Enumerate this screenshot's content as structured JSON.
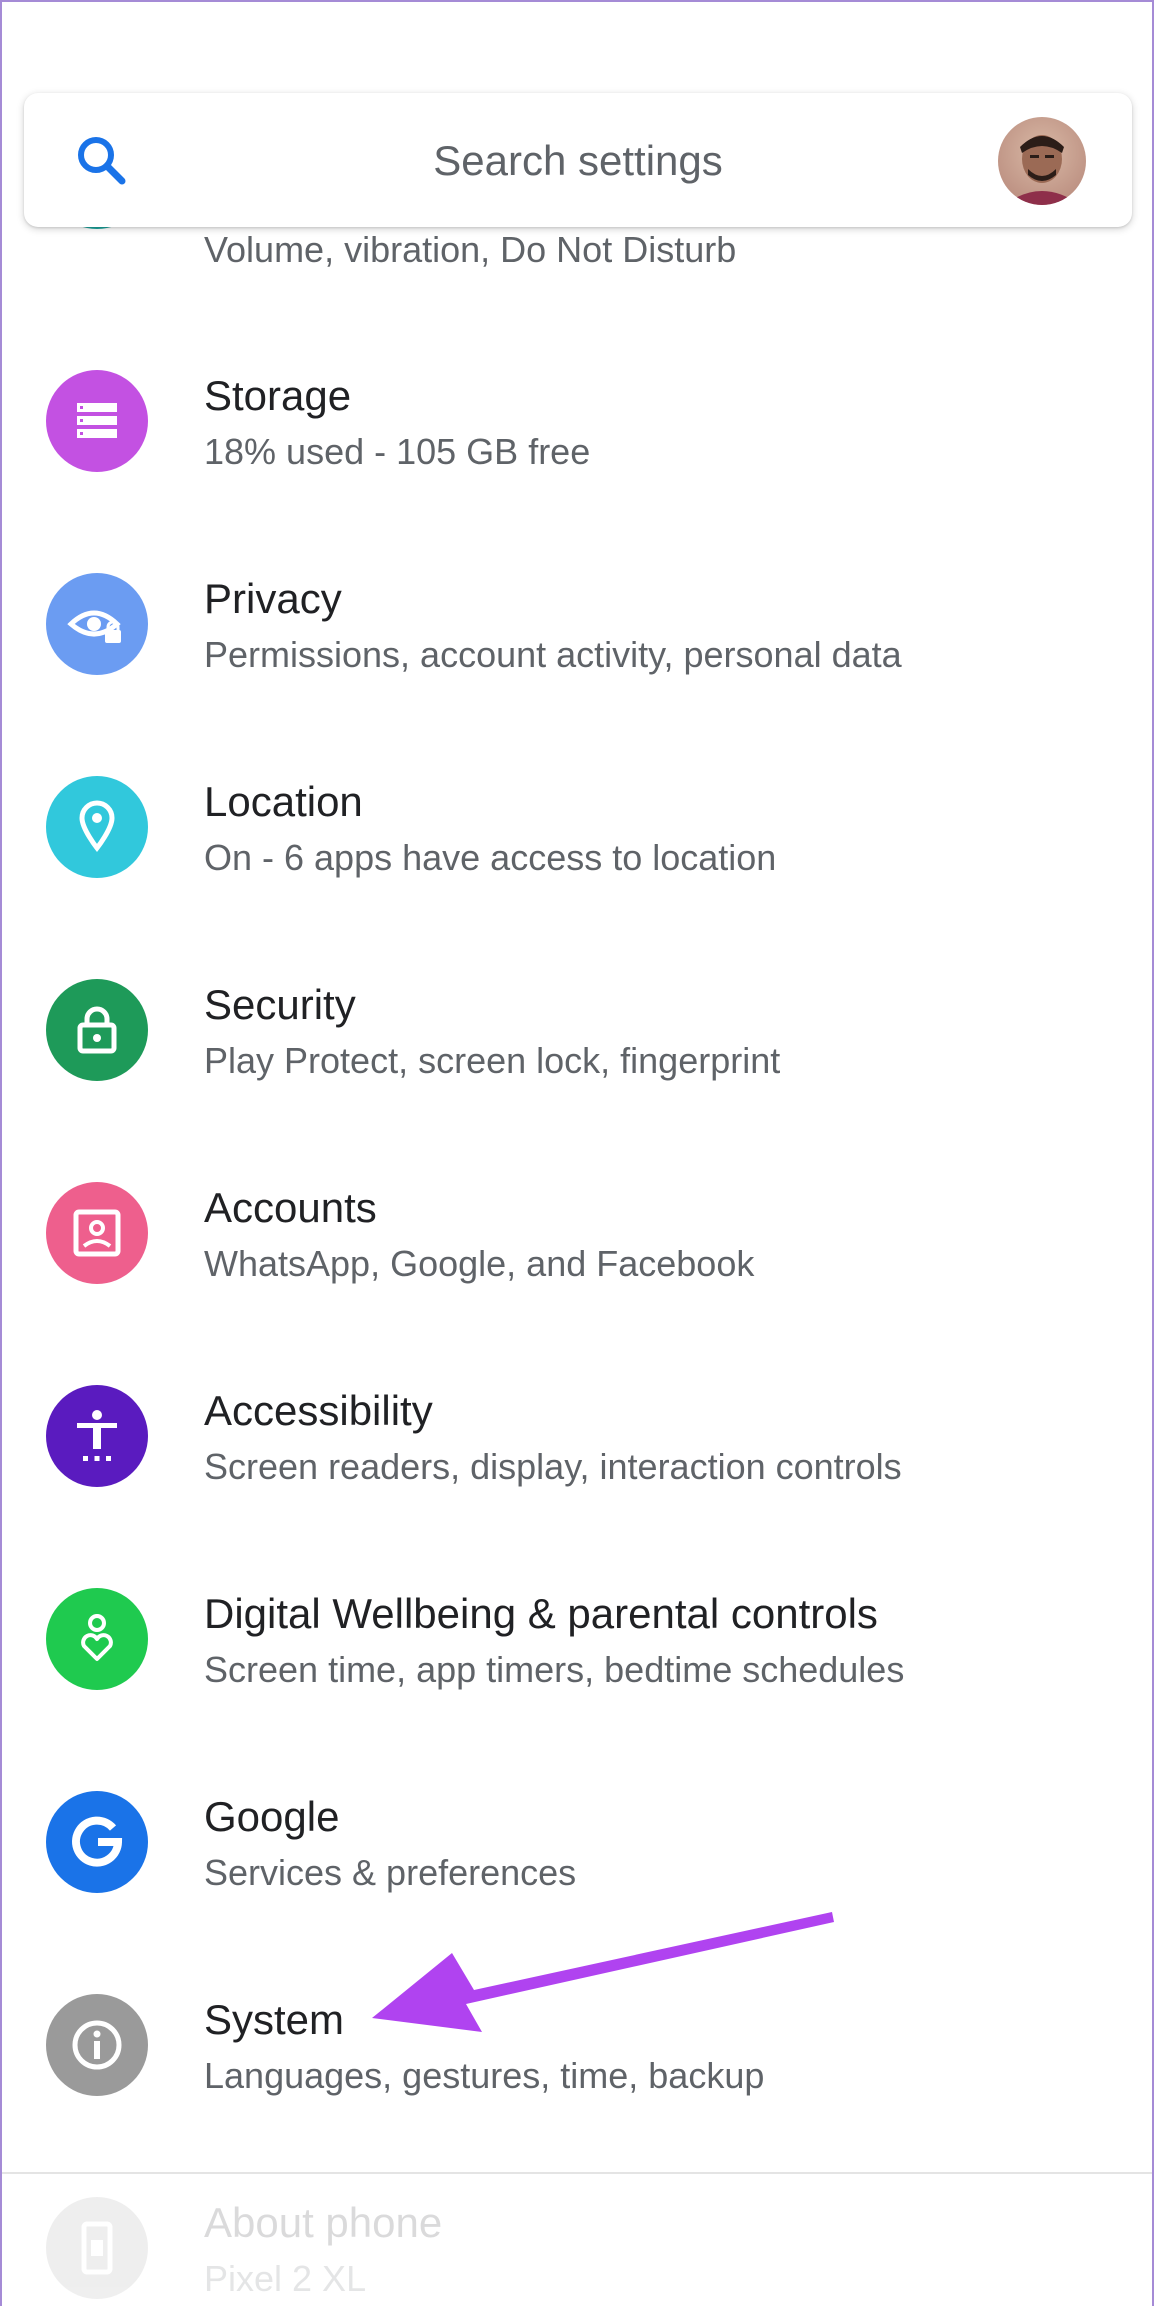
{
  "search": {
    "placeholder": "Search settings"
  },
  "colors": {
    "sound": "#1ca7a0",
    "storage": "#c351e2",
    "privacy": "#6b9cf2",
    "location": "#31c8dc",
    "security": "#1e9a59",
    "accounts": "#ee5f8d",
    "accessibility": "#5a1bbf",
    "wellbeing": "#1fca4f",
    "google": "#1a73e8",
    "system": "#9a9a9a",
    "about": "#9a9a9a",
    "annotation_arrow": "#b043f0"
  },
  "settings": {
    "sound": {
      "title": "",
      "subtitle": "Volume, vibration, Do Not Disturb",
      "icon": "volume-icon"
    },
    "storage": {
      "title": "Storage",
      "subtitle": "18% used - 105 GB free",
      "icon": "storage-icon"
    },
    "privacy": {
      "title": "Privacy",
      "subtitle": "Permissions, account activity, personal data",
      "icon": "privacy-eye-icon"
    },
    "location": {
      "title": "Location",
      "subtitle": "On - 6 apps have access to location",
      "icon": "location-pin-icon"
    },
    "security": {
      "title": "Security",
      "subtitle": "Play Protect, screen lock, fingerprint",
      "icon": "lock-icon"
    },
    "accounts": {
      "title": "Accounts",
      "subtitle": "WhatsApp, Google, and Facebook",
      "icon": "account-box-icon"
    },
    "accessibility": {
      "title": "Accessibility",
      "subtitle": "Screen readers, display, interaction controls",
      "icon": "accessibility-person-icon"
    },
    "wellbeing": {
      "title": "Digital Wellbeing & parental controls",
      "subtitle": "Screen time, app timers, bedtime schedules",
      "icon": "wellbeing-heart-icon"
    },
    "google": {
      "title": "Google",
      "subtitle": "Services & preferences",
      "icon": "google-g-icon"
    },
    "system": {
      "title": "System",
      "subtitle": "Languages, gestures, time, backup",
      "icon": "info-icon"
    },
    "about": {
      "title": "About phone",
      "subtitle": "Pixel 2 XL",
      "icon": "phone-icon"
    }
  }
}
